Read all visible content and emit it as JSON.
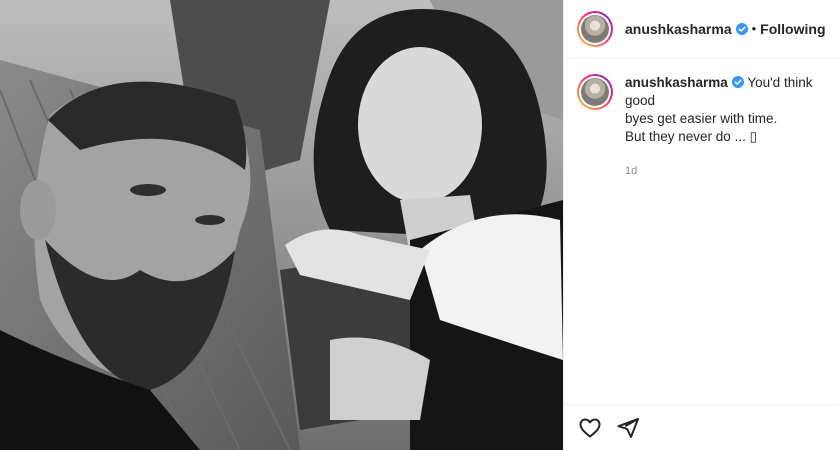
{
  "post": {
    "author": "anushkasharma",
    "verified": true,
    "separator": "•",
    "follow_state": "Following"
  },
  "caption": {
    "username": "anushkasharma",
    "line1": "You'd think good",
    "line2": "byes get easier with time.",
    "line3": "But they never do ... ▯",
    "time": "1d"
  },
  "colors": {
    "verified_badge": "#3897f0",
    "border": "#efefef",
    "muted_text": "#8e8e8e"
  },
  "icons": [
    "heart-icon",
    "share-icon",
    "verified-badge-icon"
  ]
}
